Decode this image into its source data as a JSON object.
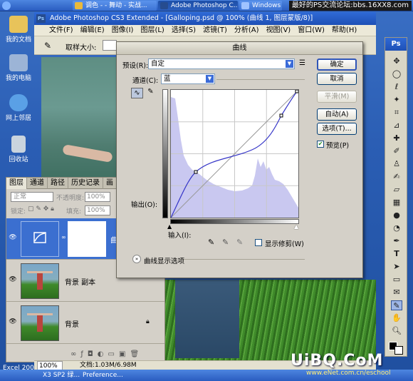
{
  "taskbar_top": {
    "buttons": [
      "调色 - - 舞动 - 实战...",
      "Adobe Photoshop C...",
      "Windows M..."
    ],
    "watermark": "最好的PS交流论坛:bbs.16XX8.com"
  },
  "desktop_icons": [
    "我的文档",
    "我的电脑",
    "网上邻居",
    "回收站"
  ],
  "photoshop": {
    "title": "Adobe Photoshop CS3 Extended - [Galloping.psd @ 100% (曲线 1, 图层蒙版/8)]",
    "menu": [
      "文件(F)",
      "编辑(E)",
      "图像(I)",
      "图层(L)",
      "选择(S)",
      "滤镜(T)",
      "分析(A)",
      "视图(V)",
      "窗口(W)",
      "帮助(H)"
    ],
    "options_label": "取样大小:",
    "status_zoom": "100%",
    "status_doc": "文档:1.03M/6.98M"
  },
  "tools_title": "Ps",
  "layers_panel": {
    "tabs": [
      "图层",
      "通道",
      "路径",
      "历史记录",
      "画"
    ],
    "blend_mode": "正常",
    "opacity_label": "不透明度:",
    "opacity_value": "100%",
    "lock_label": "锁定:",
    "fill_label": "填充:",
    "fill_value": "100%",
    "layers": [
      {
        "name": "曲",
        "selected": true
      },
      {
        "name": "背景 副本",
        "selected": false
      },
      {
        "name": "背景",
        "selected": false
      }
    ]
  },
  "curves_dialog": {
    "title": "曲线",
    "preset_label": "预设(R):",
    "preset_value": "自定",
    "channel_label": "通道(C):",
    "channel_value": "蓝",
    "output_label": "输出(O):",
    "input_label": "输入(I):",
    "show_clipping_label": "显示修剪(W)",
    "display_options_label": "曲线显示选项",
    "buttons": {
      "ok": "确定",
      "cancel": "取消",
      "smooth": "平滑(M)",
      "auto": "自动(A)",
      "options": "选项(T)..."
    },
    "preview_label": "预览(P)",
    "preview_checked": true,
    "show_clipping_checked": false
  },
  "taskbar_bottom": {
    "items": [
      "Excel 200",
      "X3 SP2 绿...",
      "Preference..."
    ]
  },
  "watermark_bottom": "UiBQ.CoM",
  "watermark_bottom_url": "www.eNet.com.cn/eschool"
}
